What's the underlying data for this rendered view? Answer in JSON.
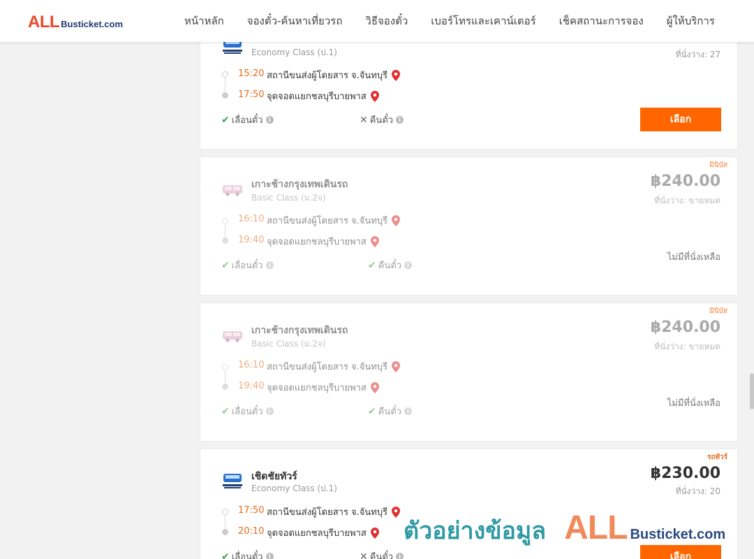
{
  "header": {
    "logo_all": "ALL",
    "logo_rest": "Busticket.com",
    "nav": [
      "หน้าหลัก",
      "จองตั๋ว-ค้นหาเที่ยวรถ",
      "วิธีจองตั๋ว",
      "เบอร์โทรและเคาน์เตอร์",
      "เช็คสถานะการจอง",
      "ผู้ให้บริการ"
    ]
  },
  "trips": [
    {
      "operator": "",
      "class": "Economy Class (ป.1)",
      "price": "",
      "seats": "ที่นั่งว่าง: 27",
      "depart_time": "15:20",
      "depart_stop": "สถานีขนส่งผู้โดยสาร จ.จันทบุรี",
      "arrive_time": "17:50",
      "arrive_stop": "จุดจอดแยกชลบุรีบายพาส",
      "feature1": "เลื่อนตั๋ว",
      "feature2": "คืนตั๋ว",
      "action": "เลือก"
    },
    {
      "tag": "มินิบัส",
      "operator": "เกาะช้างกรุงเทพเดินรถ",
      "class": "Basic Class (ม.2จ)",
      "price": "฿240.00",
      "seats": "ที่นั่งว่าง: ขายหมด",
      "depart_time": "16:10",
      "depart_stop": "สถานีขนส่งผู้โดยสาร จ.จันทบุรี",
      "arrive_time": "19:40",
      "arrive_stop": "จุดจอดแยกชลบุรีบายพาส",
      "feature1": "เลื่อนตั๋ว",
      "feature2": "คืนตั๋ว",
      "status": "ไม่มีที่นั่งเหลือ"
    },
    {
      "tag": "มินิบัส",
      "operator": "เกาะช้างกรุงเทพเดินรถ",
      "class": "Basic Class (ม.2จ)",
      "price": "฿240.00",
      "seats": "ที่นั่งว่าง: ขายหมด",
      "depart_time": "16:10",
      "depart_stop": "สถานีขนส่งผู้โดยสาร จ.จันทบุรี",
      "arrive_time": "19:40",
      "arrive_stop": "จุดจอดแยกชลบุรีบายพาส",
      "feature1": "เลื่อนตั๋ว",
      "feature2": "คืนตั๋ว",
      "status": "ไม่มีที่นั่งเหลือ"
    },
    {
      "tag": "รถทัวร์",
      "operator": "เชิดชัยทัวร์",
      "class": "Economy Class (ป.1)",
      "price": "฿230.00",
      "seats": "ที่นั่งว่าง: 20",
      "depart_time": "17:50",
      "depart_stop": "สถานีขนส่งผู้โดยสาร จ.จันทบุรี",
      "arrive_time": "20:10",
      "arrive_stop": "จุดจอดแยกชลบุรีบายพาส",
      "feature1": "เลื่อนตั๋ว",
      "feature2": "คืนตั๋ว",
      "action": "เลือก"
    }
  ],
  "watermark": {
    "text": "ตัวอย่างข้อมูล",
    "all": "ALL",
    "rest": "Busticket.com"
  },
  "colors": {
    "accent": "#ff6600",
    "time": "#e96a19",
    "check": "#3aa34a",
    "pin": "#e0302f",
    "brand_navy": "#1f3b73",
    "watermark_teal": "#2f9aa4"
  }
}
